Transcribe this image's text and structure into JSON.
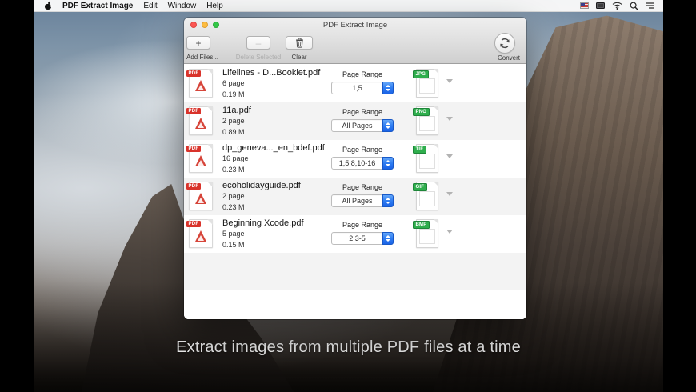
{
  "menu_bar": {
    "app_name": "PDF Extract Image",
    "menus": {
      "edit": "Edit",
      "window": "Window",
      "help": "Help"
    },
    "status_icons": [
      "us-flag-icon",
      "display-icon",
      "wifi-icon",
      "search-icon",
      "notification-center-icon"
    ]
  },
  "window": {
    "title": "PDF Extract Image",
    "toolbar": {
      "add_glyph": "+",
      "delete_glyph": "–",
      "add_files_label": "Add Files...",
      "delete_selected_label": "Delete Selected",
      "clear_label": "Clear",
      "convert_label": "Convert"
    },
    "list": {
      "pdf_badge_label": "PDF",
      "page_range_label": "Page Range",
      "rows": [
        {
          "filename": "Lifelines - D...Booklet.pdf",
          "pages": "6 page",
          "size": "0.19 M",
          "page_range": "1,5",
          "format": "JPG"
        },
        {
          "filename": "11a.pdf",
          "pages": "2 page",
          "size": "0.89 M",
          "page_range": "All Pages",
          "format": "PNG"
        },
        {
          "filename": "dp_geneva..._en_bdef.pdf",
          "pages": "16 page",
          "size": "0.23 M",
          "page_range": "1,5,8,10-16",
          "format": "TIF"
        },
        {
          "filename": "ecoholidayguide.pdf",
          "pages": "2 page",
          "size": "0.23 M",
          "page_range": "All Pages",
          "format": "GIF"
        },
        {
          "filename": "Beginning Xcode.pdf",
          "pages": "5 page",
          "size": "0.15 M",
          "page_range": "2,3-5",
          "format": "BMP"
        }
      ]
    }
  },
  "caption": "Extract images from multiple PDF files at a time",
  "colors": {
    "stepper_blue": "#2f7df2",
    "badge_green": "#2fae4d",
    "pdf_red": "#d9332b",
    "traffic_red": "#fc5753",
    "traffic_yellow": "#fdbc40",
    "traffic_green": "#33c748"
  }
}
